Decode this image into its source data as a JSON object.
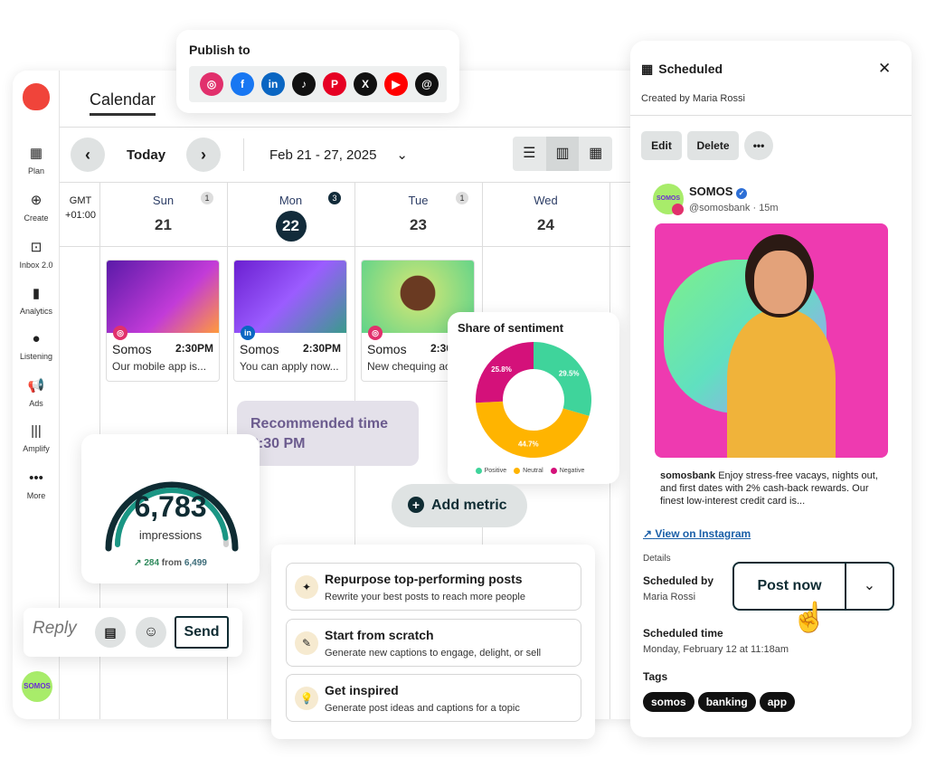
{
  "publish": {
    "title": "Publish to",
    "networks": [
      {
        "name": "instagram-icon",
        "glyph": "◎",
        "color": "#e1306c"
      },
      {
        "name": "facebook-icon",
        "glyph": "f",
        "color": "#1877f2"
      },
      {
        "name": "linkedin-icon",
        "glyph": "in",
        "color": "#0a66c2"
      },
      {
        "name": "tiktok-icon",
        "glyph": "♪",
        "color": "#111111"
      },
      {
        "name": "pinterest-icon",
        "glyph": "P",
        "color": "#e60023"
      },
      {
        "name": "x-icon",
        "glyph": "X",
        "color": "#111111"
      },
      {
        "name": "youtube-icon",
        "glyph": "▶",
        "color": "#ff0000"
      },
      {
        "name": "threads-icon",
        "glyph": "@",
        "color": "#111111"
      }
    ]
  },
  "sidebar": {
    "items": [
      {
        "label": "Plan",
        "icon": "▦"
      },
      {
        "label": "Create",
        "icon": "⊕"
      },
      {
        "label": "Inbox 2.0",
        "icon": "⊡"
      },
      {
        "label": "Analytics",
        "icon": "▮"
      },
      {
        "label": "Listening",
        "icon": "●"
      },
      {
        "label": "Ads",
        "icon": "📢"
      },
      {
        "label": "Amplify",
        "icon": "|||"
      },
      {
        "label": "More",
        "icon": "•••"
      }
    ],
    "avatar": "SOMOS"
  },
  "calendar": {
    "title": "Calendar",
    "today": "Today",
    "range": "Feb 21 - 27, 2025",
    "timezone": "GMT +01:00",
    "days": [
      {
        "name": "Sun",
        "date": "21",
        "count": "1"
      },
      {
        "name": "Mon",
        "date": "22",
        "count": "3"
      },
      {
        "name": "Tue",
        "date": "23",
        "count": "1"
      },
      {
        "name": "Wed",
        "date": "24"
      }
    ],
    "posts": [
      {
        "author": "Somos",
        "time": "2:30PM",
        "caption": "Our mobile app is...",
        "network": "instagram"
      },
      {
        "author": "Somos",
        "time": "2:30PM",
        "caption": "You can apply now...",
        "network": "linkedin"
      },
      {
        "author": "Somos",
        "time": "2:30PM",
        "caption": "New chequing ac",
        "network": "instagram"
      }
    ]
  },
  "recommended": {
    "label": "Recommended time",
    "time": "2:30 PM"
  },
  "impressions": {
    "value": "6,783",
    "label": "impressions",
    "delta": "284",
    "from_label": "from",
    "previous": "6,499",
    "progress": 0.96
  },
  "chart_data": {
    "type": "pie",
    "title": "Share of sentiment",
    "categories": [
      "Positive",
      "Neutral",
      "Negative"
    ],
    "values": [
      29.5,
      44.7,
      25.8
    ],
    "labels": [
      "29.5%",
      "44.7%",
      "25.8%"
    ],
    "colors": [
      "#3fd49b",
      "#ffb400",
      "#d4117a"
    ],
    "legend": "bottom",
    "donut": true
  },
  "add_metric": "Add metric",
  "reply": {
    "placeholder": "Reply",
    "send": "Send"
  },
  "suggestions": [
    {
      "title": "Repurpose top-performing posts",
      "subtitle": "Rewrite your best posts to reach more people",
      "icon": "✦"
    },
    {
      "title": "Start from scratch",
      "subtitle": "Generate new captions to engage, delight, or sell",
      "icon": "✎"
    },
    {
      "title": "Get inspired",
      "subtitle": "Generate post ideas and captions for a topic",
      "icon": "💡"
    }
  ],
  "panel": {
    "title": "Scheduled",
    "created_by": "Created by Maria Rossi",
    "edit": "Edit",
    "delete": "Delete",
    "more": "•••",
    "account": "SOMOS",
    "handle": "@somosbank · 15m",
    "caption_user": "somosbank",
    "caption": "Enjoy stress-free vacays, nights out, and first dates with 2% cash-back rewards. Our finest low-interest credit card is...",
    "view_link": "View on Instagram",
    "details": "Details",
    "scheduled_by_label": "Scheduled by",
    "scheduled_by": "Maria Rossi",
    "post_now": "Post now",
    "scheduled_time_label": "Scheduled time",
    "scheduled_time": "Monday, February 12 at 11:18am",
    "tags_label": "Tags",
    "tags": [
      "somos",
      "banking",
      "app"
    ]
  }
}
